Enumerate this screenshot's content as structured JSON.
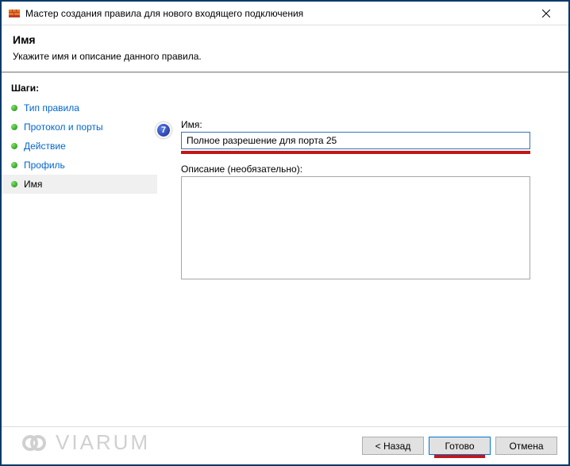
{
  "window": {
    "title": "Мастер создания правила для нового входящего подключения"
  },
  "header": {
    "title": "Имя",
    "description": "Укажите имя и описание данного правила."
  },
  "sidebar": {
    "heading": "Шаги:",
    "items": [
      {
        "label": "Тип правила"
      },
      {
        "label": "Протокол и порты"
      },
      {
        "label": "Действие"
      },
      {
        "label": "Профиль"
      },
      {
        "label": "Имя"
      }
    ]
  },
  "annotation": {
    "number": "7"
  },
  "form": {
    "name_label": "Имя:",
    "name_value": "Полное разрешение для порта 25",
    "desc_label": "Описание (необязательно):",
    "desc_value": ""
  },
  "footer": {
    "back": "< Назад",
    "finish": "Готово",
    "cancel": "Отмена"
  },
  "watermark": {
    "text": "VIARUM"
  }
}
